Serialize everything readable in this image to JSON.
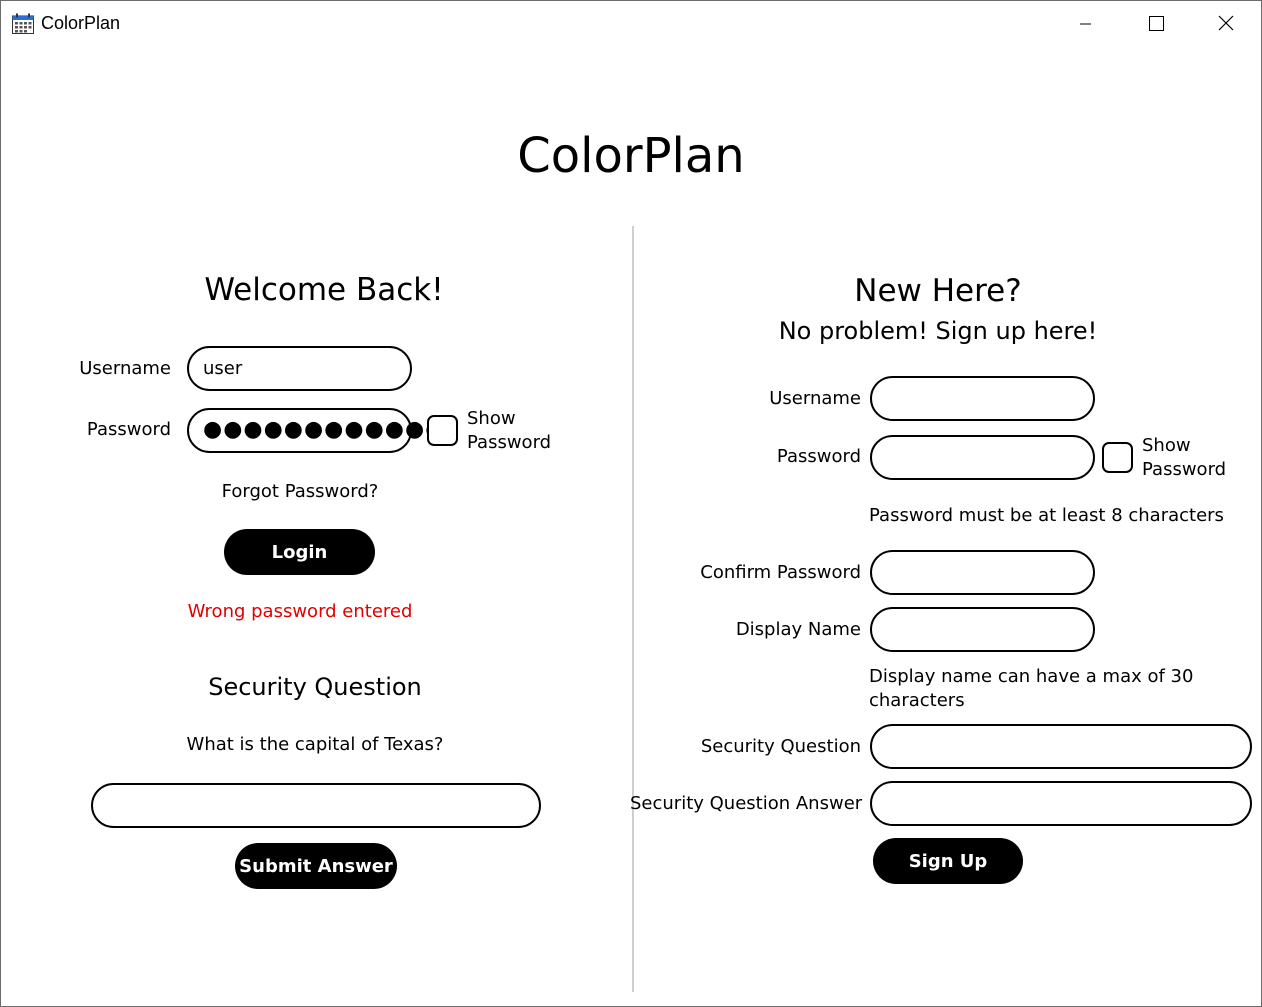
{
  "window": {
    "title": "ColorPlan",
    "icon": "calendar-icon",
    "controls": [
      "minimize-icon",
      "maximize-icon",
      "close-icon"
    ]
  },
  "app_title": "ColorPlan",
  "login": {
    "heading": "Welcome Back!",
    "username_label": "Username",
    "username_value": "user",
    "password_label": "Password",
    "password_value": "●●●●●●●●●●●●",
    "show_password_label": "Show Password",
    "show_password_checked": false,
    "forgot_password": "Forgot Password?",
    "login_button": "Login",
    "error": "Wrong password entered",
    "error_color": "#e00000",
    "security_heading": "Security Question",
    "security_question": "What is the capital of Texas?",
    "security_answer_value": "",
    "submit_button": "Submit Answer"
  },
  "signup": {
    "heading": "New Here?",
    "subheading": "No problem! Sign up here!",
    "username_label": "Username",
    "password_label": "Password",
    "show_password_label": "Show Password",
    "show_password_checked": false,
    "password_hint": "Password must be at least 8 characters",
    "confirm_password_label": "Confirm Password",
    "display_name_label": "Display Name",
    "display_name_hint": "Display name can have a max of 30 characters",
    "security_question_label": "Security Question",
    "security_answer_label": "Security Question Answer",
    "signup_button": "Sign Up"
  }
}
